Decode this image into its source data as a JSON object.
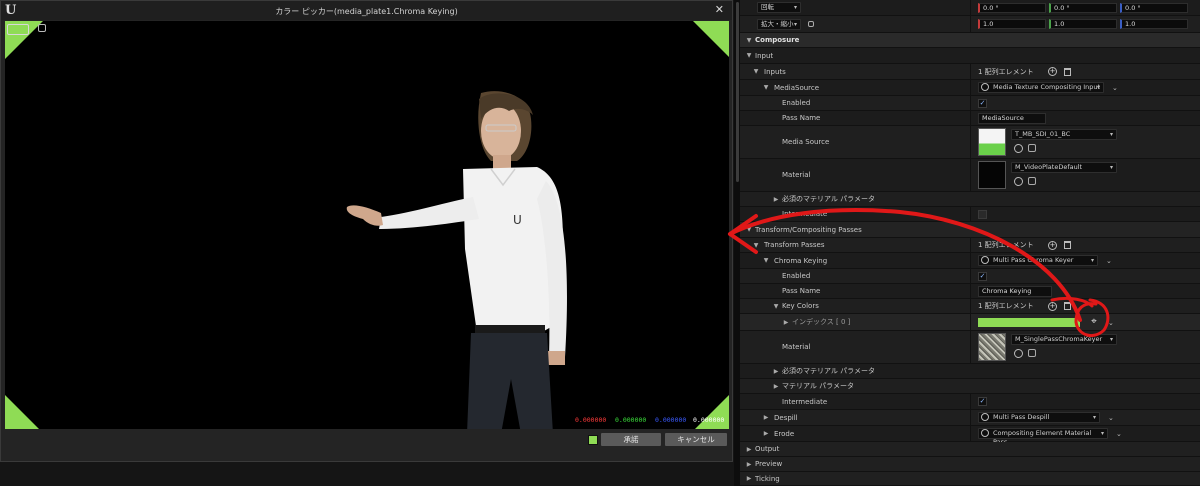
{
  "picker": {
    "title": "カラー ピッカー(media_plate1.Chroma Keying)",
    "close_glyph": "✕",
    "logo_glyph": "U",
    "readouts": {
      "red": "0.000000",
      "green": "0.000000",
      "blue": "0.000000",
      "alpha": "0.000000"
    },
    "ok_label": "承諾",
    "cancel_label": "キャンセル",
    "color": "#8fdc55"
  },
  "details": {
    "rotate_label": "回転",
    "rotate_values": [
      "0.0 °",
      "0.0 °",
      "0.0 °"
    ],
    "scale_label": "拡大・縮小",
    "scale_values": [
      "1.0",
      "1.0",
      "1.0"
    ],
    "composure_label": "Composure",
    "input_label": "Input",
    "inputs_label": "Inputs",
    "inputs_count": "1 配列エレメント",
    "mediasource_label": "MediaSource",
    "mediasource_value": "Media Texture Compositing Input",
    "enabled_label": "Enabled",
    "pass_name_label": "Pass Name",
    "pass_name_value": "MediaSource",
    "media_source_label": "Media Source",
    "media_source_value": "T_MB_SDI_01_BC",
    "material_label": "Material",
    "material_value": "M_VideoPlateDefault",
    "required_params_label": "必須のマテリアル パラメータ",
    "intermediate_label": "Intermediate",
    "transform_compositing_label": "Transform/Compositing Passes",
    "transform_passes_label": "Transform Passes",
    "transform_passes_count": "1 配列エレメント",
    "chroma_keying_label": "Chroma Keying",
    "chroma_keying_value": "Multi Pass Chroma Keyer",
    "enabled2_label": "Enabled",
    "pass_name2_label": "Pass Name",
    "pass_name2_value": "Chroma Keying",
    "key_colors_label": "Key Colors",
    "key_colors_count": "1 配列エレメント",
    "index_label": "インデックス [ 0 ]",
    "material2_label": "Material",
    "material2_value": "M_SinglePassChromaKeyer",
    "required_params2_label": "必須のマテリアル パラメータ",
    "material_params_label": "マテリアル パラメータ",
    "intermediate2_label": "Intermediate",
    "despill_label": "Despill",
    "despill_value": "Multi Pass Despill",
    "erode_label": "Erode",
    "erode_value": "Compositing Element Material Pass",
    "output_label": "Output",
    "preview_label": "Preview",
    "ticking_label": "Ticking",
    "key_color": "#8fdc55",
    "axis_colors": [
      "#c43a3a",
      "#4aa24a",
      "#3a5ec4"
    ]
  },
  "annotation": {
    "color": "#e01818"
  }
}
